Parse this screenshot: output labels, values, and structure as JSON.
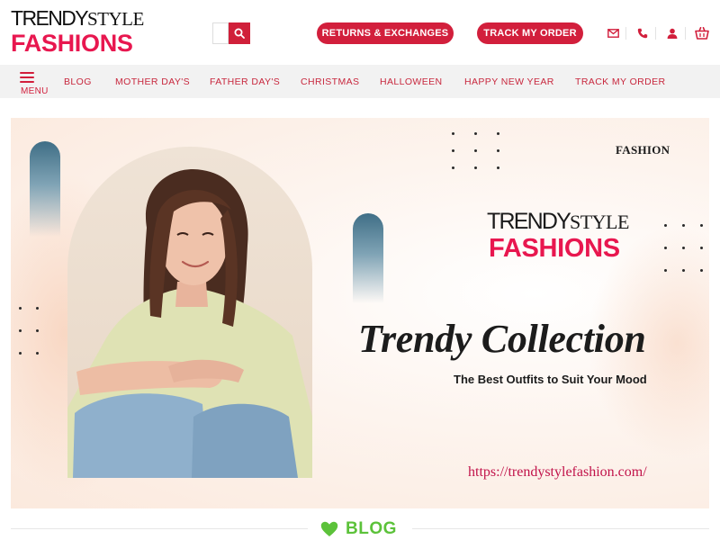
{
  "header": {
    "logo_top": "TRENDY",
    "logo_top_style": "STYLE",
    "logo_bottom": "FASHIONS",
    "returns_label": "RETURNS & EXCHANGES",
    "track_label": "TRACK MY ORDER",
    "accent_color": "#d21f3c"
  },
  "nav": {
    "menu_label": "MENU",
    "items": [
      {
        "label": "BLOG"
      },
      {
        "label": "MOTHER DAY'S"
      },
      {
        "label": "FATHER DAY'S"
      },
      {
        "label": "CHRISTMAS"
      },
      {
        "label": "HALLOWEEN"
      },
      {
        "label": "HAPPY NEW YEAR"
      },
      {
        "label": "TRACK MY ORDER"
      }
    ]
  },
  "hero": {
    "tag": "FASHION",
    "logo_top": "TRENDY",
    "logo_top_style": "STYLE",
    "logo_bottom": "FASHIONS",
    "title": "Trendy Collection",
    "subtitle": "The Best Outfits to Suit Your Mood",
    "url": "https://trendystylefashion.com/"
  },
  "section": {
    "heading": "BLOG",
    "heading_color": "#5cc23a"
  }
}
